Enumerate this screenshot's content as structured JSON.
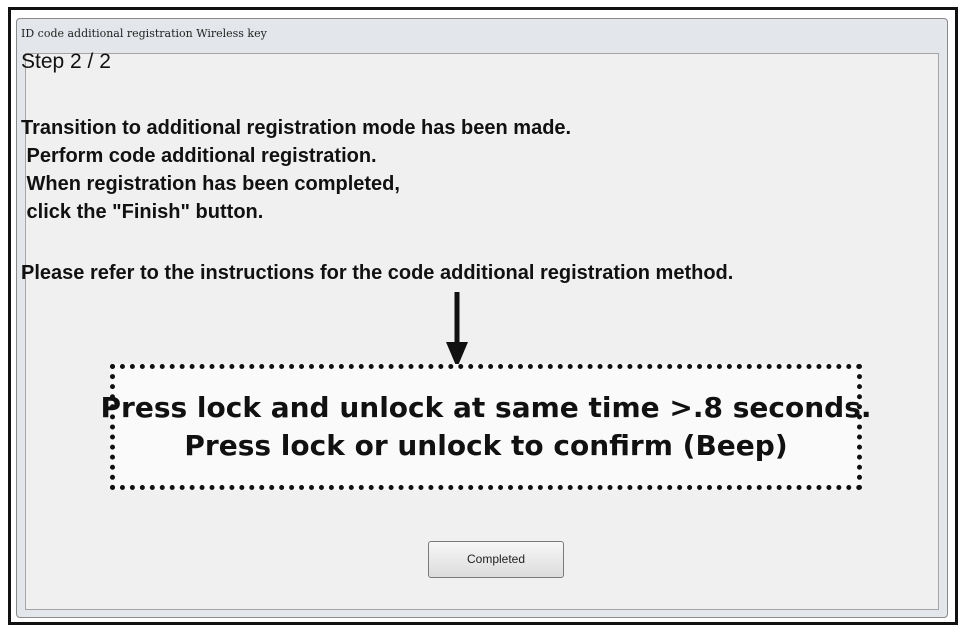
{
  "window": {
    "title": "ID code additional registration  Wireless key"
  },
  "content": {
    "step": "Step 2 / 2",
    "lines": [
      "Transition to additional registration mode has been made.",
      " Perform code additional registration.",
      " When registration has been completed,",
      " click the \"Finish\" button."
    ],
    "refer": "Please refer to the instructions for the code additional registration method."
  },
  "annotation": {
    "line1": "Press lock and unlock at same time >.8 seconds.",
    "line2": "Press lock or unlock to confirm (Beep)"
  },
  "buttons": {
    "completed": "Completed"
  },
  "icons": {
    "arrow": "down-arrow-icon"
  }
}
